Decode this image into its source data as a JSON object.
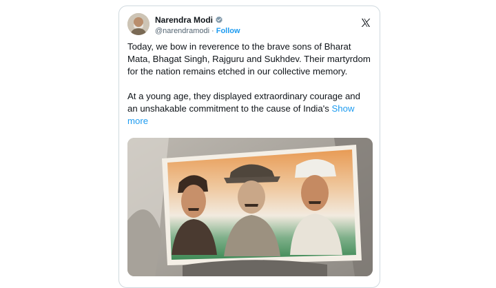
{
  "tweet": {
    "author": {
      "display_name": "Narendra Modi",
      "handle": "@narendramodi",
      "separator": "·",
      "follow_label": "Follow",
      "verified": true
    },
    "platform_icon": "x-logo-icon",
    "paragraphs": [
      "Today, we bow in reverence to the brave sons of Bharat Mata, Bhagat Singh, Rajguru and Sukhdev. Their martyrdom for the nation remains etched in our collective memory.",
      "At a young age, they displayed extraordinary courage and an unshakable commitment to the cause of India's"
    ],
    "show_more_label": "Show more",
    "media": {
      "kind": "image",
      "subject": "poster of three freedom fighters"
    }
  },
  "colors": {
    "link": "#1d9bf0",
    "text": "#0f1419",
    "secondary_text": "#536471",
    "border": "#cfd9de"
  }
}
